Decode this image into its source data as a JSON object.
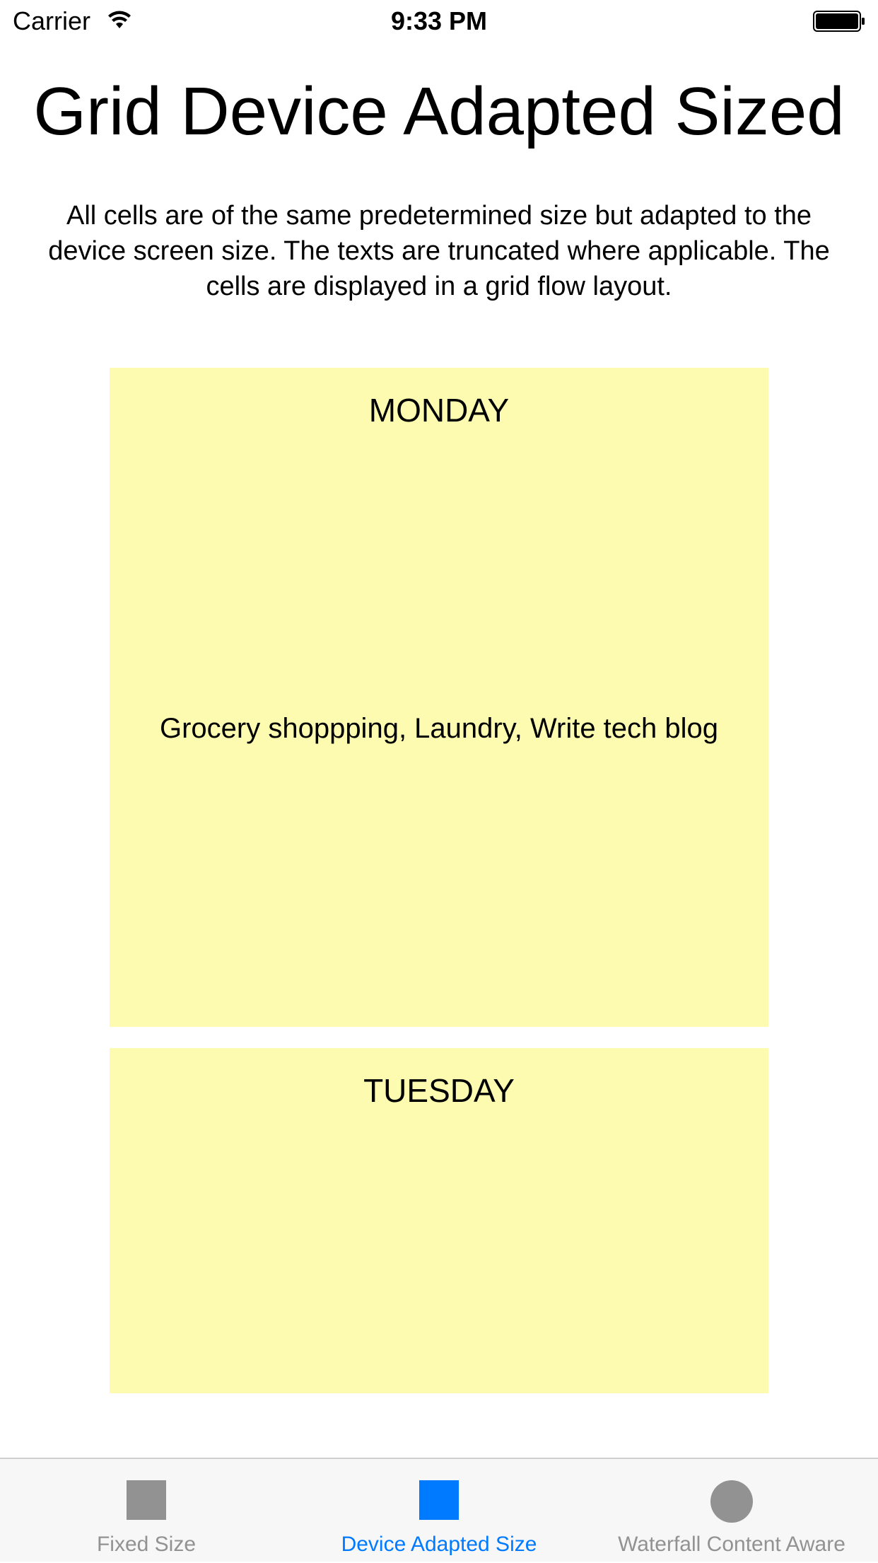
{
  "status_bar": {
    "carrier": "Carrier",
    "time": "9:33 PM",
    "wifi_icon": "wifi-icon",
    "battery_icon": "battery-full-icon"
  },
  "page": {
    "title": "Grid Device Adapted Sized",
    "description": "All cells are of the same predetermined size but adapted to the device screen size. The texts are truncated where applicable. The cells are displayed in a grid flow layout."
  },
  "cells": [
    {
      "day": "MONDAY",
      "note": "Grocery shoppping, Laundry, Write tech blog"
    },
    {
      "day": "TUESDAY",
      "note": ""
    }
  ],
  "tab_bar": {
    "tabs": [
      {
        "label": "Fixed Size",
        "icon": "square-icon",
        "active": false
      },
      {
        "label": "Device Adapted Size",
        "icon": "square-icon",
        "active": true
      },
      {
        "label": "Waterfall Content Aware",
        "icon": "circle-icon",
        "active": false
      }
    ]
  },
  "colors": {
    "cell_background": "#fdfbb0",
    "tab_active": "#007aff",
    "tab_inactive": "#929292",
    "tab_bar_background": "#f7f7f7"
  }
}
